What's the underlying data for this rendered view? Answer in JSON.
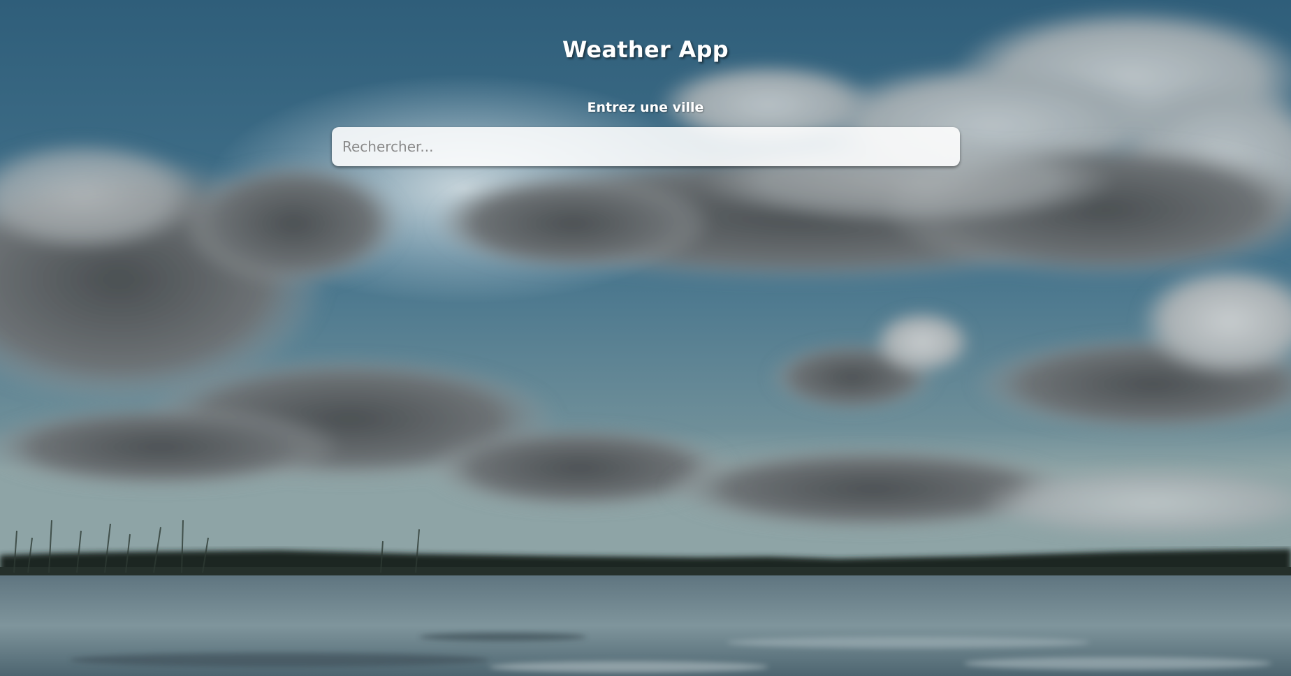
{
  "header": {
    "title": "Weather App"
  },
  "search": {
    "label": "Entrez une ville",
    "placeholder": "Rechercher...",
    "value": ""
  },
  "colors": {
    "sky": "#3f6b82",
    "text": "#ffffff",
    "input_bg": "#f0f0f0"
  }
}
